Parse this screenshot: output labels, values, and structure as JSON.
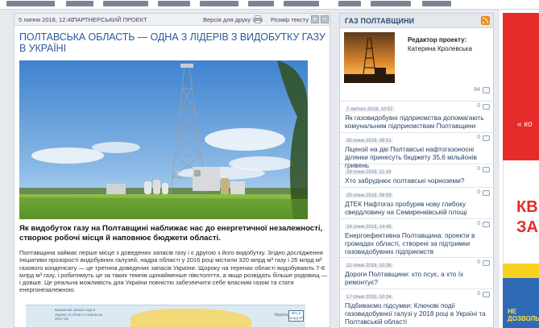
{
  "article": {
    "date": "5 липня 2018, 12:40",
    "tag": "ПАРТНЕРСЬКИЙ ПРОЕКТ",
    "print_label": "Версія для друку",
    "font_size_label": "Розмір тексту",
    "font_plus": "+",
    "font_minus": "–",
    "title": "ПОЛТАВСЬКА ОБЛАСТЬ — ОДНА З ЛІДЕРІВ З ВИДОБУТКУ ГАЗУ В УКРАЇНІ",
    "lead": "Як видобуток газу на Полтавщині наближає нас до енергетичної незалежності, створює робочі місця й наповнює бюджети області.",
    "body": "Полтавщина займає перше місце з доведених запасів газу і є другою з його видобутку. Згідно дослідження Ініціативи прозорості видобувних галузей, надра області у 2016 році містили 320 млрд м³ газу і 26 млрд м³ газового конденсату — це третина доведених запасів України. Щороку на теренах області видобувають 7-8 млрд м³ газу, і робитимуть це за таких темпів щонайменше півстоліття, а якщо розвідать більше родовищ — і довше. Це реальна можливість для України повністю забезпечити себе власним газом та стати енергонезалежною.",
    "infographic": {
      "caption": "Балансові запаси газу в Україні та області станом на 2017 рік",
      "country": "Україна",
      "badge": "901,6 млрд м³"
    }
  },
  "sidebar": {
    "title": "ГАЗ ПОЛТАВЩИНИ",
    "editor_label": "Редактор проекту:",
    "editor_name": "Катерина Кролевська",
    "editor_count": "84",
    "news": [
      {
        "date": "7 лютого 2019, 10:57",
        "count": "0",
        "title": "Як газовидобувні підприємства допомагають комунальним підприємствам Полтавщини"
      },
      {
        "date": "30 січня 2019, 09:51",
        "count": "0",
        "title": "Ліцензії на дві Полтавські нафтогазоносні ділянки принесуть бюджету 35,6 мільйонів гривень"
      },
      {
        "date": "29 січня 2019, 11:19",
        "count": "0",
        "title": "Хто забруднює полтавські чорноземи?"
      },
      {
        "date": "25 січня 2019, 09:59",
        "count": "0",
        "title": "ДТЕК Нафтогаз пробурив нову глибоку свердловину на Семиренківській площі"
      },
      {
        "date": "24 січня 2019, 14:45",
        "count": "0",
        "title": "Енергоефективна Полтавщина: проекти в громадах області, створені за підтримки газовидобувних підприємств"
      },
      {
        "date": "22 січня 2019, 10:38",
        "count": "0",
        "title": "Дороги Полтавщини: хто псує, а хто їх ремонтує?"
      },
      {
        "date": "17 січня 2019, 10:34",
        "count": "0",
        "title": "Підбиваємо підсумки: Ключові події газовидобувної галузі у 2018 році в Україні та Полтавській області"
      }
    ]
  },
  "ad": {
    "text1": "« ко",
    "text2": "КВ",
    "text3": "ЗА",
    "text4": "НЕ ДОЗВОЛЬ"
  }
}
